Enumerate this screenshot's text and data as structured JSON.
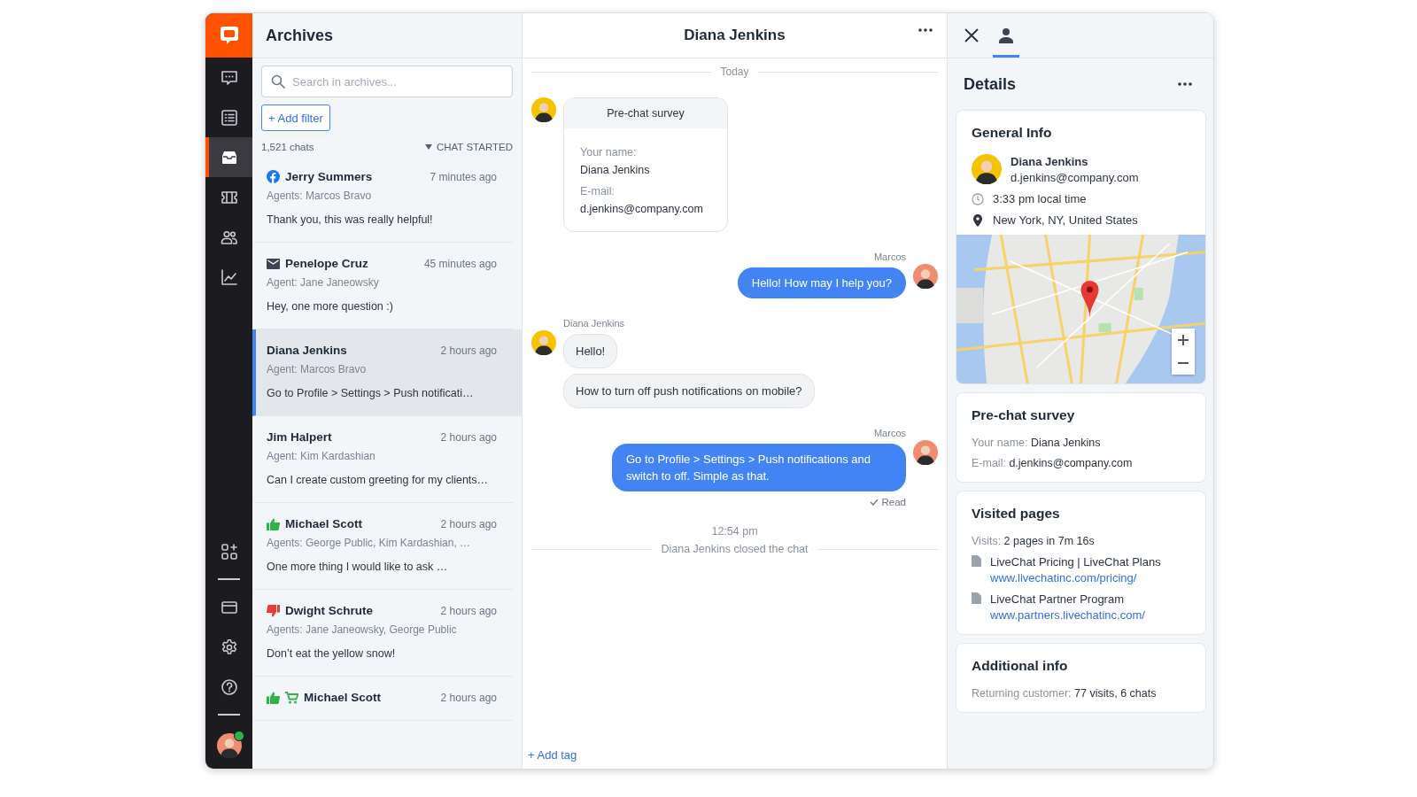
{
  "rail": {
    "top_items": [
      {
        "kind": "chats",
        "selected": false
      },
      {
        "kind": "list",
        "selected": false
      },
      {
        "kind": "archives",
        "selected": true
      },
      {
        "kind": "tickets",
        "selected": false
      },
      {
        "kind": "customers",
        "selected": false
      },
      {
        "kind": "reports",
        "selected": false
      }
    ],
    "bottom_groups": [
      [
        {
          "kind": "apps",
          "selected": false
        }
      ],
      [
        {
          "kind": "billing",
          "selected": false
        },
        {
          "kind": "settings",
          "selected": false
        },
        {
          "kind": "help",
          "selected": false
        }
      ]
    ],
    "profile": {
      "online": true
    }
  },
  "archives": {
    "title": "Archives",
    "search": {
      "placeholder": "Search in archives..."
    },
    "add_filter": "+ Add filter",
    "count": "1,521 chats",
    "sort": "CHAT STARTED",
    "chats": [
      {
        "name": "Jerry Summers",
        "time": "7 minutes ago",
        "agents": "Agents: Marcos Bravo",
        "message": "Thank you, this was really helpful!",
        "icons": [
          {
            "kind": "facebook"
          }
        ],
        "selected": false
      },
      {
        "name": "Penelope Cruz",
        "time": "45 minutes ago",
        "agents": "Agent: Jane Janeowsky",
        "message": "Hey, one more question :)",
        "icons": [
          {
            "kind": "email"
          }
        ],
        "selected": false
      },
      {
        "name": "Diana Jenkins",
        "time": "2 hours ago",
        "agents": "Agent: Marcos Bravo",
        "message": "Go to Profile > Settings > Push notificati…",
        "selected": true
      },
      {
        "name": "Jim Halpert",
        "time": "2 hours ago",
        "agents": "Agent: Kim Kardashian",
        "message": "Can I create custom greeting for my clients…",
        "selected": false
      },
      {
        "name": "Michael Scott",
        "time": "2 hours ago",
        "agents": "Agents: George Public, Kim Kardashian, …",
        "message": "One more thing I would like to ask …",
        "icons": [
          {
            "kind": "thumb-up"
          }
        ],
        "selected": false
      },
      {
        "name": "Dwight Schrute",
        "time": "2 hours ago",
        "agents": "Agents: Jane Janeowsky, George Public",
        "message": "Don’t eat the yellow snow!",
        "icons": [
          {
            "kind": "thumb-down"
          }
        ],
        "selected": false
      },
      {
        "name": "Michael Scott",
        "time": "2 hours ago",
        "icons": [
          {
            "kind": "thumb-up"
          },
          {
            "kind": "cart"
          }
        ],
        "selected": false
      }
    ]
  },
  "chat": {
    "title": "Diana Jenkins",
    "day": "Today",
    "messages": [
      {
        "kind": "survey",
        "title": "Pre-chat survey",
        "fields": [
          {
            "label": "Your name:",
            "value": "Diana Jenkins"
          },
          {
            "label": "E-mail:",
            "value": "d.jenkins@company.com"
          }
        ]
      },
      {
        "kind": "agent",
        "author": "Marcos",
        "bubbles": [
          "Hello! How may I help you?"
        ]
      },
      {
        "kind": "customer",
        "author": "Diana Jenkins",
        "bubbles": [
          "Hello!",
          "How to turn off push notifications on mobile?"
        ]
      },
      {
        "kind": "agent",
        "author": "Marcos",
        "bubbles": [
          "Go to Profile > Settings > Push notifications and switch to off. Simple as that."
        ],
        "status": "Read"
      }
    ],
    "closed_time": "12:54 pm",
    "closed_text": "Diana Jenkins closed the chat",
    "add_tag": "+ Add tag"
  },
  "details": {
    "title": "Details",
    "general": {
      "title": "General Info",
      "name": "Diana Jenkins",
      "email": "d.jenkins@company.com",
      "local_time": "3:33 pm local time",
      "location": "New York, NY, United States"
    },
    "prechat": {
      "title": "Pre-chat survey",
      "fields": [
        {
          "label": "Your name:",
          "value": "Diana Jenkins"
        },
        {
          "label": "E-mail:",
          "value": "d.jenkins@company.com"
        }
      ]
    },
    "visited": {
      "title": "Visited pages",
      "label": "Visits:",
      "value": "2 pages in 7m 16s",
      "pages": [
        {
          "title": "LiveChat Pricing | LiveChat Plans",
          "url": "www.livechatinc.com/pricing/"
        },
        {
          "title": "LiveChat Partner Program",
          "url": "www.partners.livechatinc.com/"
        }
      ]
    },
    "additional": {
      "title": "Additional info",
      "fields": [
        {
          "label": "Returning customer:",
          "value": "77 visits, 6 chats"
        }
      ]
    }
  }
}
